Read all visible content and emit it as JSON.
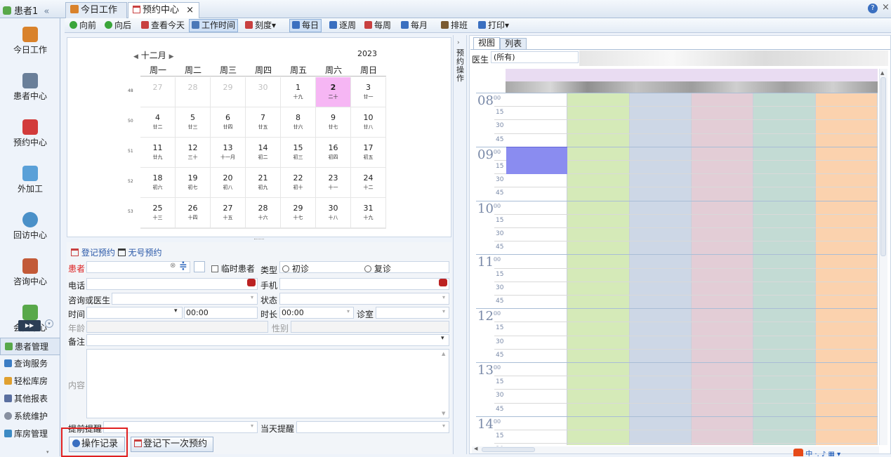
{
  "header": {
    "sidebar_title": "患者1",
    "tabs": [
      {
        "label": "今日工作"
      },
      {
        "label": "预约中心"
      }
    ],
    "close": "×",
    "help": "?",
    "win_close": "×"
  },
  "sidebar": {
    "big_items": [
      {
        "label": "今日工作",
        "color": "#d9822b"
      },
      {
        "label": "患者中心",
        "color": "#6a7f99"
      },
      {
        "label": "预约中心",
        "color": "#d23b3b"
      },
      {
        "label": "外加工",
        "color": "#5aa0d8"
      },
      {
        "label": "回访中心",
        "color": "#4a90c8"
      },
      {
        "label": "咨询中心",
        "color": "#c25a38"
      },
      {
        "label": "会员中心",
        "color": "#58a84a"
      }
    ],
    "expand": "▶▶",
    "small_items": [
      {
        "label": "患者管理",
        "color": "#58a84a"
      },
      {
        "label": "查询服务",
        "color": "#3c7dc4"
      },
      {
        "label": "轻松库房",
        "color": "#e0a030"
      },
      {
        "label": "其他报表",
        "color": "#5a6fa0"
      },
      {
        "label": "系统维护",
        "color": "#8890a0"
      },
      {
        "label": "库房管理",
        "color": "#3c8ac4"
      }
    ]
  },
  "toolbar": {
    "items": [
      {
        "label": "向前",
        "color": "#3aa53a"
      },
      {
        "label": "向后",
        "color": "#3aa53a"
      },
      {
        "label": "查看今天",
        "color": "#c84040"
      },
      {
        "label": "工作时间",
        "color": "#4a78b8",
        "pressed": true
      },
      {
        "label": "刻度▾",
        "color": "#c84040"
      },
      {
        "label": "每日",
        "color": "#3a6fc0",
        "pressed": true
      },
      {
        "label": "逐周",
        "color": "#3a6fc0"
      },
      {
        "label": "每周",
        "color": "#c84040"
      },
      {
        "label": "每月",
        "color": "#3a6fc0"
      },
      {
        "label": "排班",
        "color": "#7a5a30"
      },
      {
        "label": "打印▾",
        "color": "#3a6fc0"
      }
    ]
  },
  "calendar": {
    "month": "十二月",
    "year": "2023",
    "weekdays": [
      "周一",
      "周二",
      "周三",
      "周四",
      "周五",
      "周六",
      "周日"
    ],
    "weeks": [
      {
        "num": "48",
        "days": [
          {
            "d": "27",
            "l": "",
            "g": true
          },
          {
            "d": "28",
            "l": "",
            "g": true
          },
          {
            "d": "29",
            "l": "",
            "g": true
          },
          {
            "d": "30",
            "l": "",
            "g": true
          },
          {
            "d": "1",
            "l": "十九"
          },
          {
            "d": "2",
            "l": "二十",
            "sel": true
          },
          {
            "d": "3",
            "l": "廿一"
          }
        ]
      },
      {
        "num": "50",
        "days": [
          {
            "d": "4",
            "l": "廿二"
          },
          {
            "d": "5",
            "l": "廿三"
          },
          {
            "d": "6",
            "l": "廿四"
          },
          {
            "d": "7",
            "l": "廿五"
          },
          {
            "d": "8",
            "l": "廿六"
          },
          {
            "d": "9",
            "l": "廿七"
          },
          {
            "d": "10",
            "l": "廿八"
          }
        ]
      },
      {
        "num": "51",
        "days": [
          {
            "d": "11",
            "l": "廿九"
          },
          {
            "d": "12",
            "l": "三十"
          },
          {
            "d": "13",
            "l": "十一月"
          },
          {
            "d": "14",
            "l": "初二"
          },
          {
            "d": "15",
            "l": "初三"
          },
          {
            "d": "16",
            "l": "初四"
          },
          {
            "d": "17",
            "l": "初五"
          }
        ]
      },
      {
        "num": "52",
        "days": [
          {
            "d": "18",
            "l": "初六"
          },
          {
            "d": "19",
            "l": "初七"
          },
          {
            "d": "20",
            "l": "初八"
          },
          {
            "d": "21",
            "l": "初九"
          },
          {
            "d": "22",
            "l": "初十"
          },
          {
            "d": "23",
            "l": "十一"
          },
          {
            "d": "24",
            "l": "十二"
          }
        ]
      },
      {
        "num": "53",
        "days": [
          {
            "d": "25",
            "l": "十三"
          },
          {
            "d": "26",
            "l": "十四"
          },
          {
            "d": "27",
            "l": "十五"
          },
          {
            "d": "28",
            "l": "十六"
          },
          {
            "d": "29",
            "l": "十七"
          },
          {
            "d": "30",
            "l": "十八"
          },
          {
            "d": "31",
            "l": "十九"
          }
        ]
      }
    ]
  },
  "form": {
    "register_tab": "登记预约",
    "noid_tab": "无号预约",
    "patient_label": "患者",
    "temp_patient": "临时患者",
    "type_label": "类型",
    "type_first": "初诊",
    "type_return": "复诊",
    "phone_label": "电话",
    "mobile_label": "手机",
    "doctor_label": "咨询或医生",
    "status_label": "状态",
    "time_label": "时间",
    "time_value": "00:00",
    "duration_label": "时长",
    "duration_value": "00:00",
    "room_label": "诊室",
    "age_label": "年龄",
    "gender_label": "性别",
    "remark_label": "备注",
    "content_label": "内容",
    "early_remind_label": "提前提醒",
    "day_remind_label": "当天提醒",
    "op_record_button": "操作记录",
    "next_appt_button": "登记下一次预约"
  },
  "splitter_label": "预约操作",
  "schedule": {
    "tabs": [
      "视图",
      "列表"
    ],
    "doctor_label": "医生",
    "doctor_value": "(所有)",
    "hours": [
      "08",
      "09",
      "10",
      "11",
      "12",
      "13",
      "14"
    ],
    "minute_marks": [
      "15",
      "30",
      "45"
    ],
    "hour_sup": "00",
    "column_colors": [
      "#ffffff",
      "#d5eab8",
      "#cdd7e6",
      "#e3cdd6",
      "#c3dbd4",
      "#fbd2ae"
    ],
    "appointment_color": "#8a8cf0"
  },
  "ime": {
    "label": "中"
  }
}
